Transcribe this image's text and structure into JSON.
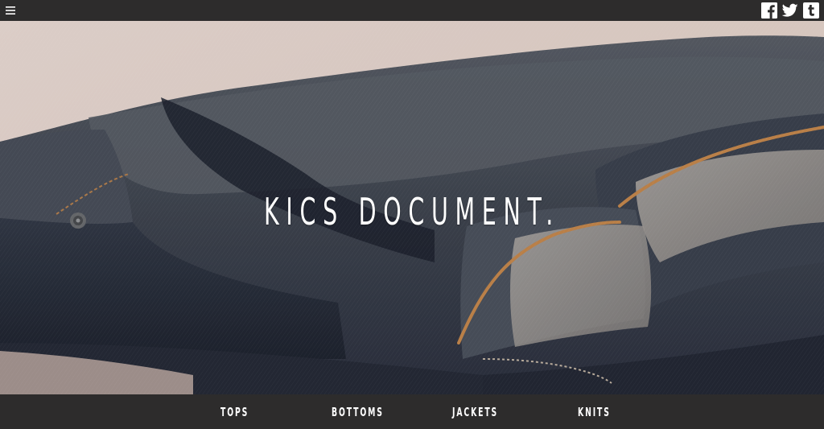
{
  "header": {
    "menu_icon": "hamburger-menu-icon",
    "social": [
      {
        "name": "facebook",
        "icon": "facebook-icon"
      },
      {
        "name": "twitter",
        "icon": "twitter-icon"
      },
      {
        "name": "tumblr",
        "icon": "tumblr-icon"
      }
    ]
  },
  "hero": {
    "title": "KICS DOCUMENT.",
    "image": "close-up of folded raw denim jeans"
  },
  "nav": {
    "items": [
      {
        "label": "TOPS"
      },
      {
        "label": "BOTTOMS"
      },
      {
        "label": "JACKETS"
      },
      {
        "label": "KNITS"
      }
    ]
  },
  "colors": {
    "bar": "#2d2c2c",
    "text": "#ffffff",
    "denim": "#3a4250",
    "backdrop": "#e9d8d0",
    "stitch": "#c98a4e"
  }
}
